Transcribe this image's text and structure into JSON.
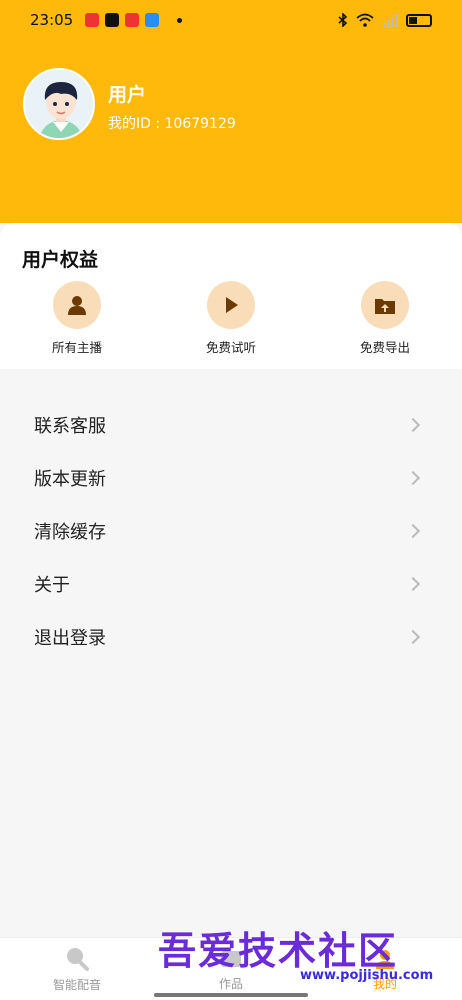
{
  "status_bar": {
    "time": "23:05"
  },
  "header": {
    "user_name": "用户",
    "user_id": "我的ID : 10679129"
  },
  "benefits": {
    "title": "用户权益",
    "items": [
      {
        "label": "所有主播",
        "icon": "person-icon"
      },
      {
        "label": "免费试听",
        "icon": "play-icon"
      },
      {
        "label": "免费导出",
        "icon": "export-icon"
      }
    ]
  },
  "menu": {
    "items": [
      {
        "label": "联系客服"
      },
      {
        "label": "版本更新"
      },
      {
        "label": "清除缓存"
      },
      {
        "label": "关于"
      },
      {
        "label": "退出登录"
      }
    ]
  },
  "tabbar": {
    "tabs": [
      {
        "label": "智能配音"
      },
      {
        "label": "作品"
      },
      {
        "label": "我的"
      }
    ]
  },
  "watermark": {
    "text": "吾爱技术社区",
    "url": "www.pojjishu.com"
  },
  "colors": {
    "accent": "#FFB90B",
    "icon_bg": "#F9DDB9",
    "icon_fg": "#6B3A00"
  }
}
